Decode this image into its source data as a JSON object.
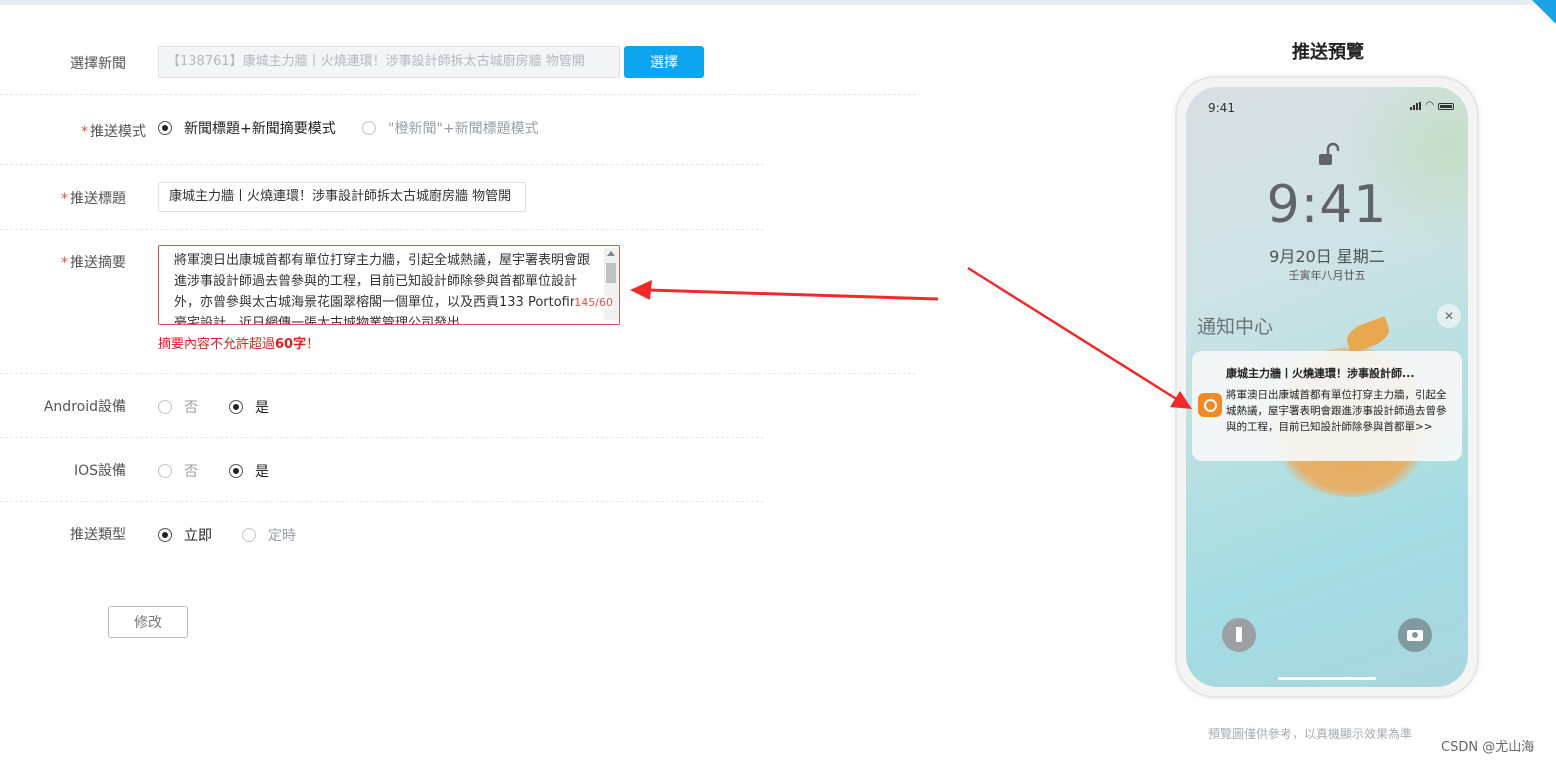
{
  "form": {
    "select_news_label": "選擇新聞",
    "selected_news_value": "【138761】康城主力牆丨火燒連環！涉事設計師拆太古城廚房牆 物管開",
    "select_button": "選擇",
    "required_mark": "*",
    "push_mode_label": "推送模式",
    "push_mode_options": [
      "新聞標題+新聞摘要模式",
      "\"橙新聞\"+新聞標題模式"
    ],
    "push_title_label": "推送標題",
    "push_title_value": "康城主力牆丨火燒連環！涉事設計師拆太古城廚房牆 物管開",
    "push_summary_label": "推送摘要",
    "push_summary_value": "將軍澳日出康城首都有單位打穿主力牆，引起全城熱議，屋宇署表明會跟進涉事設計師過去曾參與的工程，目前已知設計師除參與首都單位設計外，亦曾參與太古城海景花園翠榕閣一個單位，以及西貢133 Portofino豪宅設計，近日網傳一張太古城物業管理公司發出",
    "summary_counter": "145/60",
    "summary_warning_prefix": "摘要內容不允許超過",
    "summary_warning_limit": "60字",
    "summary_warning_suffix": "！",
    "android_label": "Android設備",
    "ios_label": "IOS設備",
    "no_option": "否",
    "yes_option": "是",
    "push_type_label": "推送類型",
    "push_type_options": [
      "立即",
      "定時"
    ],
    "modify_button": "修改"
  },
  "preview": {
    "title": "推送預覽",
    "status_time": "9:41",
    "lock_time": "9:41",
    "date": "9月20日 星期二",
    "lunar": "壬寅年八月廿五",
    "notification_center": "通知中心",
    "close_glyph": "✕",
    "notif_title": "康城主力牆丨火燒連環！涉事設計師...",
    "notif_body": "將軍澳日出康城首都有單位打穿主力牆，引起全城熱議，屋宇署表明會跟進涉事設計師過去曾參與的工程，目前已知設計師除參與首都單>>",
    "note": "預覽圖僅供參考，以真機顯示效果為準"
  },
  "credit": "CSDN @尤山海",
  "colors": {
    "accent": "#0ea5f0",
    "error": "#e02020",
    "arrow": "#f02a2a"
  },
  "icons": [
    "unlock-icon",
    "signal-icon",
    "wifi-icon",
    "battery-icon",
    "close-icon",
    "app-icon",
    "flashlight-icon",
    "camera-icon"
  ]
}
